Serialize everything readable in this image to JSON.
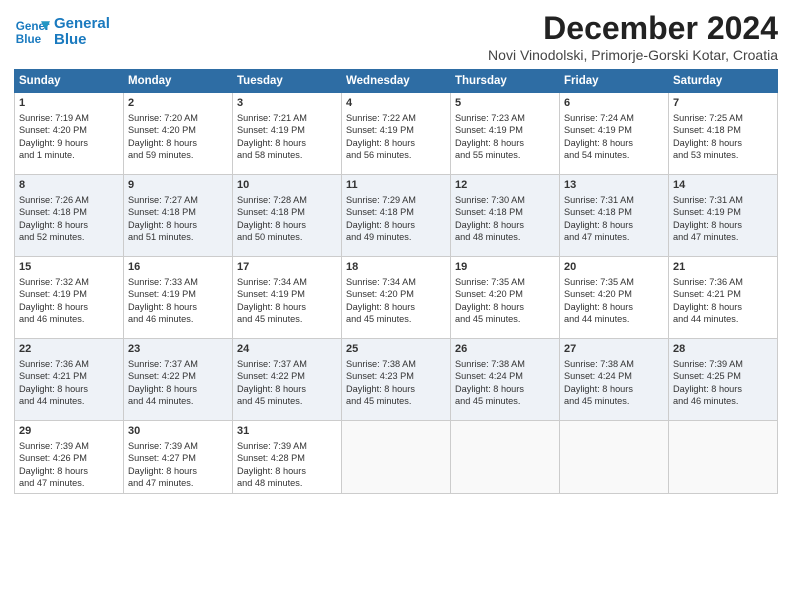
{
  "logo": {
    "line1": "General",
    "line2": "Blue"
  },
  "title": "December 2024",
  "subtitle": "Novi Vinodolski, Primorje-Gorski Kotar, Croatia",
  "headers": [
    "Sunday",
    "Monday",
    "Tuesday",
    "Wednesday",
    "Thursday",
    "Friday",
    "Saturday"
  ],
  "weeks": [
    [
      {
        "day": "1",
        "lines": [
          "Sunrise: 7:19 AM",
          "Sunset: 4:20 PM",
          "Daylight: 9 hours",
          "and 1 minute."
        ]
      },
      {
        "day": "2",
        "lines": [
          "Sunrise: 7:20 AM",
          "Sunset: 4:20 PM",
          "Daylight: 8 hours",
          "and 59 minutes."
        ]
      },
      {
        "day": "3",
        "lines": [
          "Sunrise: 7:21 AM",
          "Sunset: 4:19 PM",
          "Daylight: 8 hours",
          "and 58 minutes."
        ]
      },
      {
        "day": "4",
        "lines": [
          "Sunrise: 7:22 AM",
          "Sunset: 4:19 PM",
          "Daylight: 8 hours",
          "and 56 minutes."
        ]
      },
      {
        "day": "5",
        "lines": [
          "Sunrise: 7:23 AM",
          "Sunset: 4:19 PM",
          "Daylight: 8 hours",
          "and 55 minutes."
        ]
      },
      {
        "day": "6",
        "lines": [
          "Sunrise: 7:24 AM",
          "Sunset: 4:19 PM",
          "Daylight: 8 hours",
          "and 54 minutes."
        ]
      },
      {
        "day": "7",
        "lines": [
          "Sunrise: 7:25 AM",
          "Sunset: 4:18 PM",
          "Daylight: 8 hours",
          "and 53 minutes."
        ]
      }
    ],
    [
      {
        "day": "8",
        "lines": [
          "Sunrise: 7:26 AM",
          "Sunset: 4:18 PM",
          "Daylight: 8 hours",
          "and 52 minutes."
        ]
      },
      {
        "day": "9",
        "lines": [
          "Sunrise: 7:27 AM",
          "Sunset: 4:18 PM",
          "Daylight: 8 hours",
          "and 51 minutes."
        ]
      },
      {
        "day": "10",
        "lines": [
          "Sunrise: 7:28 AM",
          "Sunset: 4:18 PM",
          "Daylight: 8 hours",
          "and 50 minutes."
        ]
      },
      {
        "day": "11",
        "lines": [
          "Sunrise: 7:29 AM",
          "Sunset: 4:18 PM",
          "Daylight: 8 hours",
          "and 49 minutes."
        ]
      },
      {
        "day": "12",
        "lines": [
          "Sunrise: 7:30 AM",
          "Sunset: 4:18 PM",
          "Daylight: 8 hours",
          "and 48 minutes."
        ]
      },
      {
        "day": "13",
        "lines": [
          "Sunrise: 7:31 AM",
          "Sunset: 4:18 PM",
          "Daylight: 8 hours",
          "and 47 minutes."
        ]
      },
      {
        "day": "14",
        "lines": [
          "Sunrise: 7:31 AM",
          "Sunset: 4:19 PM",
          "Daylight: 8 hours",
          "and 47 minutes."
        ]
      }
    ],
    [
      {
        "day": "15",
        "lines": [
          "Sunrise: 7:32 AM",
          "Sunset: 4:19 PM",
          "Daylight: 8 hours",
          "and 46 minutes."
        ]
      },
      {
        "day": "16",
        "lines": [
          "Sunrise: 7:33 AM",
          "Sunset: 4:19 PM",
          "Daylight: 8 hours",
          "and 46 minutes."
        ]
      },
      {
        "day": "17",
        "lines": [
          "Sunrise: 7:34 AM",
          "Sunset: 4:19 PM",
          "Daylight: 8 hours",
          "and 45 minutes."
        ]
      },
      {
        "day": "18",
        "lines": [
          "Sunrise: 7:34 AM",
          "Sunset: 4:20 PM",
          "Daylight: 8 hours",
          "and 45 minutes."
        ]
      },
      {
        "day": "19",
        "lines": [
          "Sunrise: 7:35 AM",
          "Sunset: 4:20 PM",
          "Daylight: 8 hours",
          "and 45 minutes."
        ]
      },
      {
        "day": "20",
        "lines": [
          "Sunrise: 7:35 AM",
          "Sunset: 4:20 PM",
          "Daylight: 8 hours",
          "and 44 minutes."
        ]
      },
      {
        "day": "21",
        "lines": [
          "Sunrise: 7:36 AM",
          "Sunset: 4:21 PM",
          "Daylight: 8 hours",
          "and 44 minutes."
        ]
      }
    ],
    [
      {
        "day": "22",
        "lines": [
          "Sunrise: 7:36 AM",
          "Sunset: 4:21 PM",
          "Daylight: 8 hours",
          "and 44 minutes."
        ]
      },
      {
        "day": "23",
        "lines": [
          "Sunrise: 7:37 AM",
          "Sunset: 4:22 PM",
          "Daylight: 8 hours",
          "and 44 minutes."
        ]
      },
      {
        "day": "24",
        "lines": [
          "Sunrise: 7:37 AM",
          "Sunset: 4:22 PM",
          "Daylight: 8 hours",
          "and 45 minutes."
        ]
      },
      {
        "day": "25",
        "lines": [
          "Sunrise: 7:38 AM",
          "Sunset: 4:23 PM",
          "Daylight: 8 hours",
          "and 45 minutes."
        ]
      },
      {
        "day": "26",
        "lines": [
          "Sunrise: 7:38 AM",
          "Sunset: 4:24 PM",
          "Daylight: 8 hours",
          "and 45 minutes."
        ]
      },
      {
        "day": "27",
        "lines": [
          "Sunrise: 7:38 AM",
          "Sunset: 4:24 PM",
          "Daylight: 8 hours",
          "and 45 minutes."
        ]
      },
      {
        "day": "28",
        "lines": [
          "Sunrise: 7:39 AM",
          "Sunset: 4:25 PM",
          "Daylight: 8 hours",
          "and 46 minutes."
        ]
      }
    ],
    [
      {
        "day": "29",
        "lines": [
          "Sunrise: 7:39 AM",
          "Sunset: 4:26 PM",
          "Daylight: 8 hours",
          "and 47 minutes."
        ]
      },
      {
        "day": "30",
        "lines": [
          "Sunrise: 7:39 AM",
          "Sunset: 4:27 PM",
          "Daylight: 8 hours",
          "and 47 minutes."
        ]
      },
      {
        "day": "31",
        "lines": [
          "Sunrise: 7:39 AM",
          "Sunset: 4:28 PM",
          "Daylight: 8 hours",
          "and 48 minutes."
        ]
      },
      null,
      null,
      null,
      null
    ]
  ]
}
